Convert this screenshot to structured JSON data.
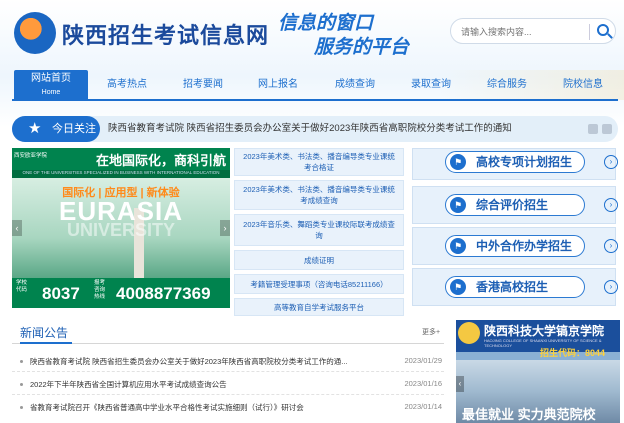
{
  "header": {
    "site_title": "陕西招生考试信息网",
    "slogan_line1": "信息的窗口",
    "slogan_line2": "服务的平台",
    "search_placeholder": "请输入搜索内容...",
    "logo_icon": "site-logo-emblem",
    "search_icon": "search-icon"
  },
  "nav": {
    "items": [
      {
        "label": "网站首页",
        "sublabel": "Home",
        "active": true
      },
      {
        "label": "高考热点"
      },
      {
        "label": "招考要闻"
      },
      {
        "label": "网上报名"
      },
      {
        "label": "成绩查询"
      },
      {
        "label": "录取查询"
      },
      {
        "label": "综合服务"
      },
      {
        "label": "院校信息"
      }
    ]
  },
  "today": {
    "tag": "今日关注",
    "text": "陕西省教育考试院 陕西省招生委员会办公室关于做好2023年陕西省高职院校分类考试工作的通知"
  },
  "banner": {
    "logo_text": "西安欧亚学院",
    "headline": "在地国际化，商科引航者",
    "sub": "ONE OF THE UNIVERSITIES SPECIALIZED IN BUSINESS WITH INTERNATIONAL EDUCATION",
    "tagline": "国际化 | 应用型 | 新体验",
    "brand": "EURASIA",
    "brand2": "UNIVERSITY",
    "code_label": "学校代码",
    "code": "8037",
    "phone_label": "报考咨询热线",
    "phone": "4008877369"
  },
  "mid_links": [
    "2023年美术类、书法类、播音编导类专业课统考合格证",
    "2023年美术类、书法类、播音编导类专业课统考成绩查询",
    "2023年音乐类、舞蹈类专业课校际联考成绩查询",
    "成绩证明",
    "考籍管理受理事项（咨询电话85211166）",
    "高等教育自学考试服务平台"
  ],
  "special": [
    {
      "label": "高校专项计划招生",
      "icon": "flag-icon"
    },
    {
      "label": "综合评价招生",
      "icon": "flag-icon"
    },
    {
      "label": "中外合作办学招生",
      "icon": "flag-icon"
    },
    {
      "label": "香港高校招生",
      "icon": "flag-icon"
    }
  ],
  "news": {
    "title": "新闻公告",
    "more": "更多+",
    "items": [
      {
        "title": "陕西省教育考试院 陕西省招生委员会办公室关于做好2023年陕西省高职院校分类考试工作的通...",
        "date": "2023/01/29"
      },
      {
        "title": "2022年下半年陕西省全国计算机应用水平考试成绩查询公告",
        "date": "2023/01/16"
      },
      {
        "title": "省教育考试院召开《陕西省普通高中学业水平合格性考试实施细则（试行）》研讨会",
        "date": "2023/01/14"
      }
    ]
  },
  "ad": {
    "name": "陕西科技大学镐京学院",
    "en": "HAOJING COLLEGE OF SHAANXI UNIVERSITY OF SCIENCE & TECHNOLOGY",
    "code": "招生代码：8044",
    "slogan": "最佳就业 实力典范院校"
  }
}
